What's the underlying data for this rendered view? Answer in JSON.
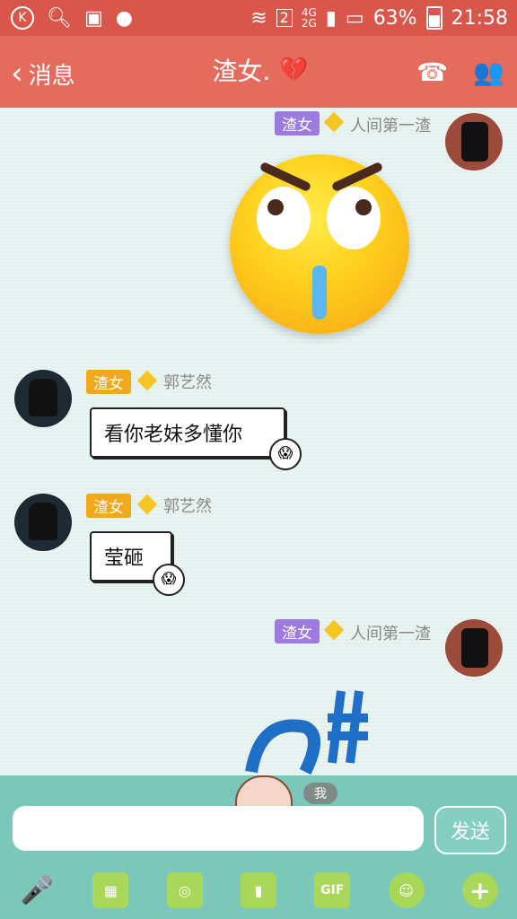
{
  "status": {
    "k_icon": "K",
    "sim": "2",
    "network": "4G",
    "network2": "2G",
    "battery": "63%",
    "time": "21:58"
  },
  "header": {
    "back_label": "消息",
    "title": "渣女.",
    "heart_icon": "broken-heart-icon"
  },
  "messages": [
    {
      "tag": "渣女",
      "name": "人间第一渣",
      "type": "sticker"
    },
    {
      "tag": "渣女",
      "name": "郭艺然",
      "text": "看你老妹多懂你"
    },
    {
      "tag": "渣女",
      "name": "郭艺然",
      "text": "莹砸"
    },
    {
      "tag": "渣女",
      "name": "人间第一渣",
      "type": "sticker"
    }
  ],
  "composer": {
    "send_label": "发送",
    "me_label": "我"
  },
  "toolbar": {
    "gif_label": "GIF",
    "plus_label": "+"
  },
  "colors": {
    "header": "#e56c5d",
    "status": "#d9564a",
    "accent": "#7bc8ba"
  }
}
